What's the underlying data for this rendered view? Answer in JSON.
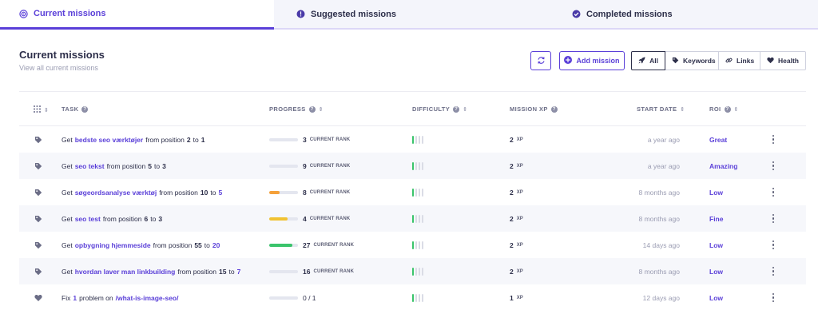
{
  "tabs": [
    {
      "label": "Current missions",
      "icon": "target-icon",
      "active": true
    },
    {
      "label": "Suggested missions",
      "icon": "exclamation-circle-icon",
      "active": false
    },
    {
      "label": "Completed missions",
      "icon": "check-circle-icon",
      "active": false
    }
  ],
  "header": {
    "title": "Current missions",
    "subtitle": "View all current missions"
  },
  "toolbar": {
    "refresh_icon": "refresh-icon",
    "add_label": "Add mission",
    "filters": [
      {
        "label": "All",
        "icon": "rocket-icon",
        "selected": true
      },
      {
        "label": "Keywords",
        "icon": "tag-icon",
        "selected": false
      },
      {
        "label": "Links",
        "icon": "link-icon",
        "selected": false
      },
      {
        "label": "Health",
        "icon": "heart-icon",
        "selected": false
      }
    ]
  },
  "columns": {
    "task": "TASK",
    "progress": "PROGRESS",
    "difficulty": "DIFFICULTY",
    "xp": "MISSION XP",
    "start": "START DATE",
    "roi": "ROI"
  },
  "labels": {
    "current_rank": "CURRENT RANK",
    "xp_unit": "XP"
  },
  "colors": {
    "accent": "#5a3fd8",
    "orange": "#f5a13a",
    "yellow": "#f1c232",
    "green": "#3ac46b"
  },
  "rows": [
    {
      "type": "keyword",
      "icon": "tag-icon",
      "prefix": "Get",
      "keyword": "bedste seo værktøjer",
      "from_text": "from position",
      "from": "2",
      "to_text": "to",
      "to": "1",
      "progress": 0,
      "rank": "3",
      "difficulty": 1,
      "xp": "2",
      "date": "a year ago",
      "roi": "Great"
    },
    {
      "type": "keyword",
      "icon": "tag-icon",
      "prefix": "Get",
      "keyword": "seo tekst",
      "from_text": "from position",
      "from": "5",
      "to_text": "to",
      "to": "3",
      "progress": 0,
      "rank": "9",
      "difficulty": 1,
      "xp": "2",
      "date": "a year ago",
      "roi": "Amazing"
    },
    {
      "type": "keyword",
      "icon": "tag-icon",
      "prefix": "Get",
      "keyword": "søgeordsanalyse værktøj",
      "from_text": "from position",
      "from": "10",
      "to_text": "to",
      "to": "5",
      "progress": 0.35,
      "progress_color": "#f5a13a",
      "rank": "8",
      "difficulty": 1,
      "xp": "2",
      "date": "8 months ago",
      "roi": "Low"
    },
    {
      "type": "keyword",
      "icon": "tag-icon",
      "prefix": "Get",
      "keyword": "seo test",
      "from_text": "from position",
      "from": "6",
      "to_text": "to",
      "to": "3",
      "progress": 0.65,
      "progress_color": "#f1c232",
      "rank": "4",
      "difficulty": 1,
      "xp": "2",
      "date": "8 months ago",
      "roi": "Fine"
    },
    {
      "type": "keyword",
      "icon": "tag-icon",
      "prefix": "Get",
      "keyword": "opbygning hjemmeside",
      "from_text": "from position",
      "from": "55",
      "to_text": "to",
      "to": "20",
      "progress": 0.8,
      "progress_color": "#3ac46b",
      "rank": "27",
      "difficulty": 1,
      "xp": "2",
      "date": "14 days ago",
      "roi": "Low"
    },
    {
      "type": "keyword",
      "icon": "tag-icon",
      "prefix": "Get",
      "keyword": "hvordan laver man linkbuilding",
      "from_text": "from position",
      "from": "15",
      "to_text": "to",
      "to": "7",
      "progress": 0,
      "rank": "16",
      "difficulty": 1,
      "xp": "2",
      "date": "8 months ago",
      "roi": "Low"
    },
    {
      "type": "health",
      "icon": "heart-icon",
      "prefix": "Fix",
      "count": "1",
      "middle": "problem on",
      "keyword": "/what-is-image-seo/",
      "progress": 0,
      "progress_text": "0 / 1",
      "difficulty": 1,
      "xp": "1",
      "date": "12 days ago",
      "roi": "Low"
    }
  ]
}
